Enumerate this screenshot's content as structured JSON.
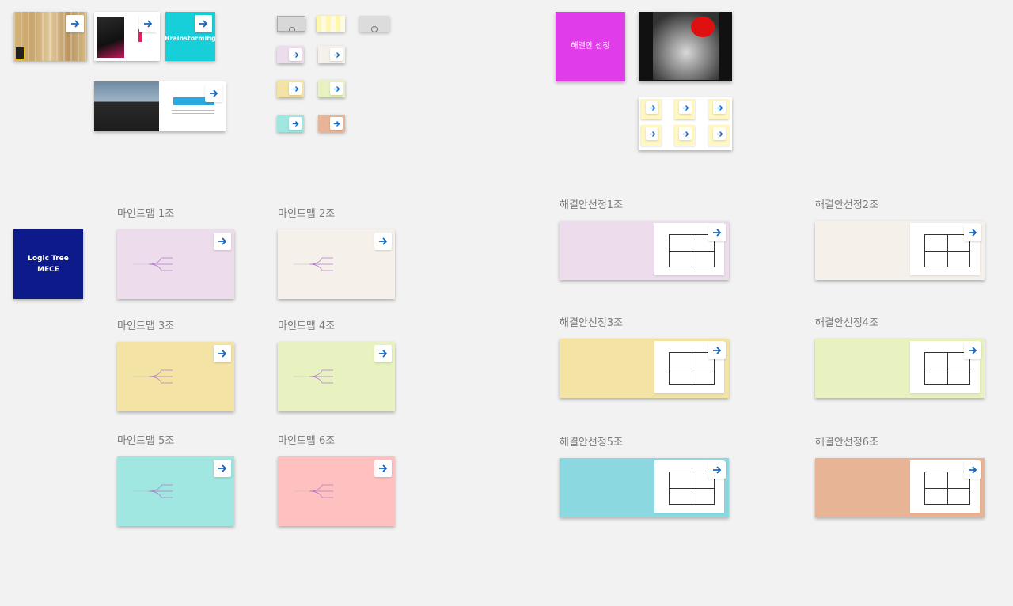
{
  "arrow_icon": "arrow-right-icon",
  "accent": "#1565c0",
  "top_cards": {
    "brainstorming": "Brainstorming",
    "logic_tree": "Logic Tree\nMECE",
    "solution_select": "해결안 선정"
  },
  "mindmaps": [
    {
      "label": "마인드맵 1조",
      "color": "#ecdcec"
    },
    {
      "label": "마인드맵 2조",
      "color": "#f5f0ea"
    },
    {
      "label": "마인드맵 3조",
      "color": "#f3e3a4"
    },
    {
      "label": "마인드맵 4조",
      "color": "#e8f2c0"
    },
    {
      "label": "마인드맵 5조",
      "color": "#9fe7e0"
    },
    {
      "label": "마인드맵 6조",
      "color": "#ffc0c0"
    }
  ],
  "solutions": [
    {
      "label": "해결안선정1조",
      "color": "#ecdcec"
    },
    {
      "label": "해결안선정2조",
      "color": "#f5f0ea"
    },
    {
      "label": "해결안선정3조",
      "color": "#f3e3a4"
    },
    {
      "label": "해결안선정4조",
      "color": "#e8f2c0"
    },
    {
      "label": "해결안선정5조",
      "color": "#8cd8e0"
    },
    {
      "label": "해결안선정6조",
      "color": "#e8b496"
    }
  ]
}
